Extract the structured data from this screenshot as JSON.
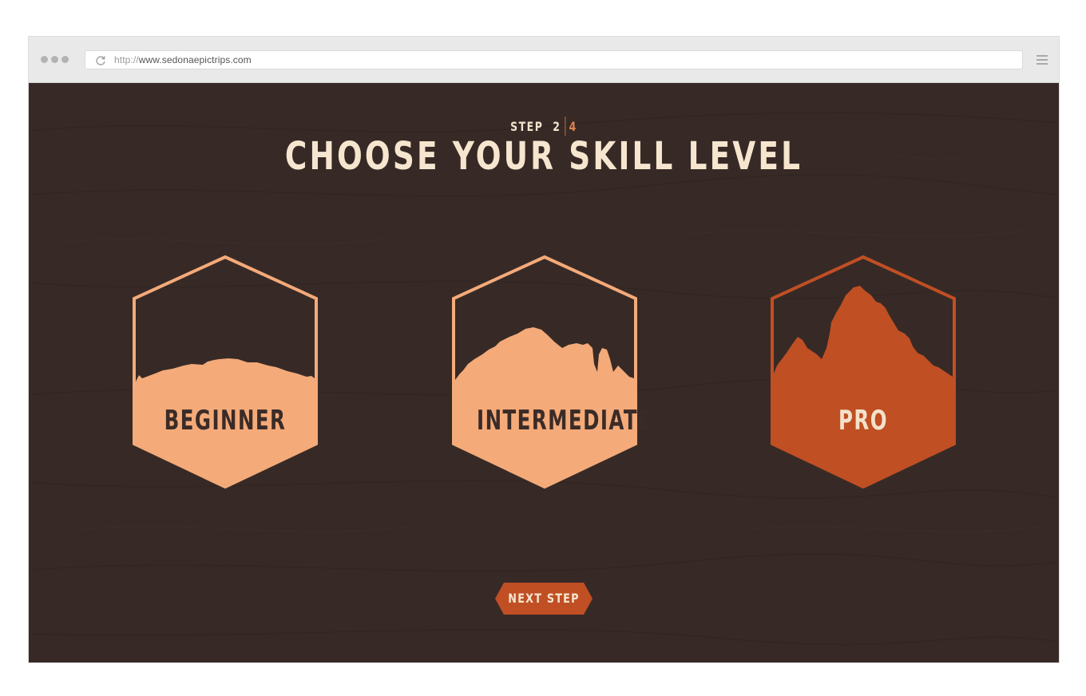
{
  "browser": {
    "url_protocol": "http://",
    "url_host": "www.sedonaepictrips.com"
  },
  "step": {
    "label": "STEP",
    "current": "2",
    "total": "4"
  },
  "page_title": "CHOOSE YOUR SKILL LEVEL",
  "skill_levels": [
    {
      "label": "BEGINNER",
      "selected": false
    },
    {
      "label": "INTERMEDIATE",
      "selected": false
    },
    {
      "label": "PRO",
      "selected": true
    }
  ],
  "next_button": {
    "label": "NEXT STEP"
  },
  "colors": {
    "background": "#372a26",
    "light_orange": "#f4aa79",
    "pro_orange": "#c04f24",
    "cream_text": "#f6e6cf",
    "accent": "#e2844f"
  },
  "icons": {
    "reload": "reload-icon",
    "menu": "hamburger-menu-icon"
  }
}
